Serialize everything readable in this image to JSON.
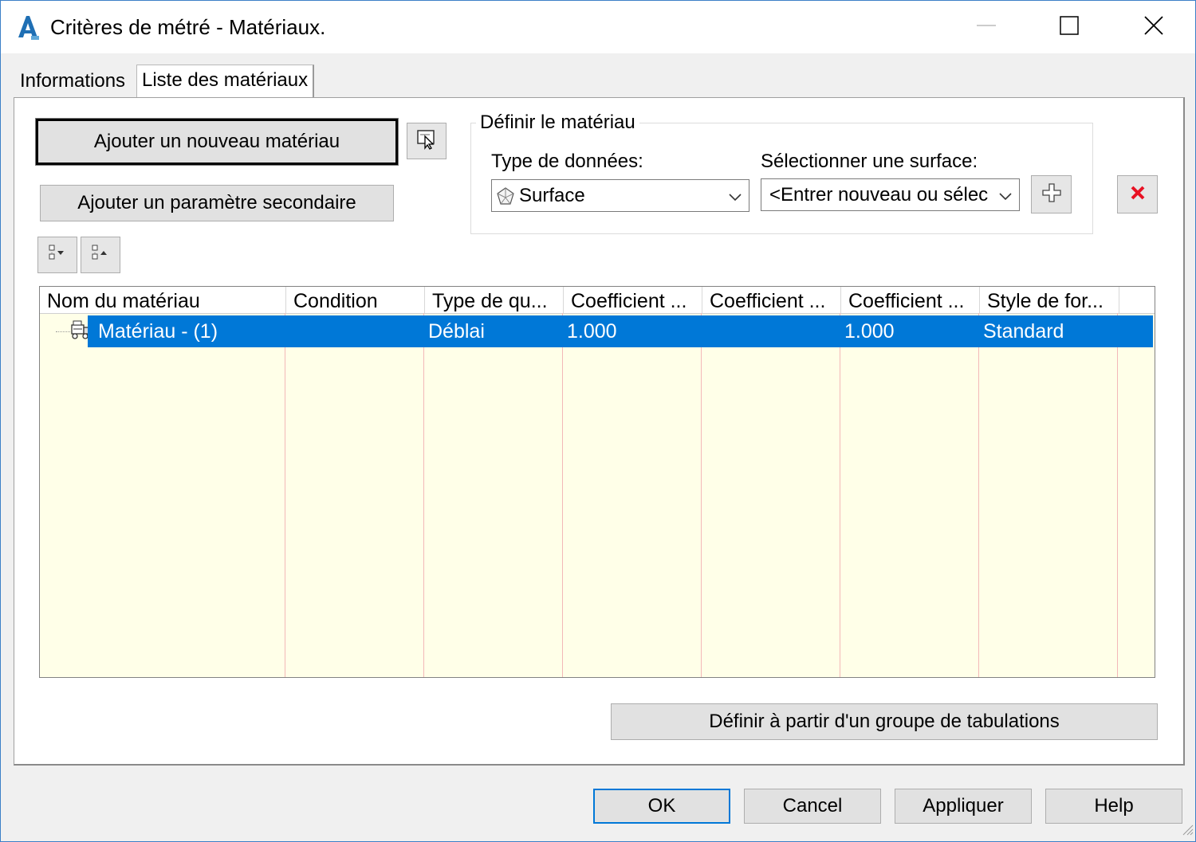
{
  "window": {
    "title": "Critères de métré - Matériaux.",
    "app_icon": "autocad-a-icon",
    "controls": {
      "minimize_icon": "minimize-icon",
      "maximize_icon": "maximize-icon",
      "close_icon": "close-icon"
    }
  },
  "tabs": [
    {
      "label": "Informations",
      "active": false
    },
    {
      "label": "Liste des matériaux",
      "active": true
    }
  ],
  "actions": {
    "add_material_label": "Ajouter un nouveau matériau",
    "add_secondary_label": "Ajouter un paramètre secondaire",
    "pick_icon": "pick-from-drawing-icon",
    "expand_icon": "expand-tree-icon",
    "collapse_icon": "collapse-tree-icon"
  },
  "define_material": {
    "group_label": "Définir le matériau",
    "data_type_label": "Type de données:",
    "data_type_value": "Surface",
    "data_type_icon": "surface-icon",
    "surface_label": "Sélectionner une surface:",
    "surface_value": "<Entrer nouveau ou sélec",
    "add_icon": "add-icon",
    "delete_icon": "delete-icon"
  },
  "grid": {
    "columns": [
      "Nom du matériau",
      "Condition",
      "Type de qu...",
      "Coefficient ...",
      "Coefficient ...",
      "Coefficient ...",
      "Style de for..."
    ],
    "rows": [
      {
        "icon": "material-icon",
        "name": "Matériau - (1)",
        "condition": "",
        "type": "Déblai",
        "coef1": "1.000",
        "coef2": "",
        "coef3": "1.000",
        "style": "Standard"
      }
    ]
  },
  "tabulation_button_label": "Définir à partir d'un groupe de tabulations",
  "footer": {
    "ok": "OK",
    "cancel": "Cancel",
    "apply": "Appliquer",
    "help": "Help"
  },
  "colors": {
    "selection": "#0078d7",
    "grid_bg": "#ffffe8",
    "grid_line": "#f3b8b8",
    "delete_red": "#e81123"
  }
}
